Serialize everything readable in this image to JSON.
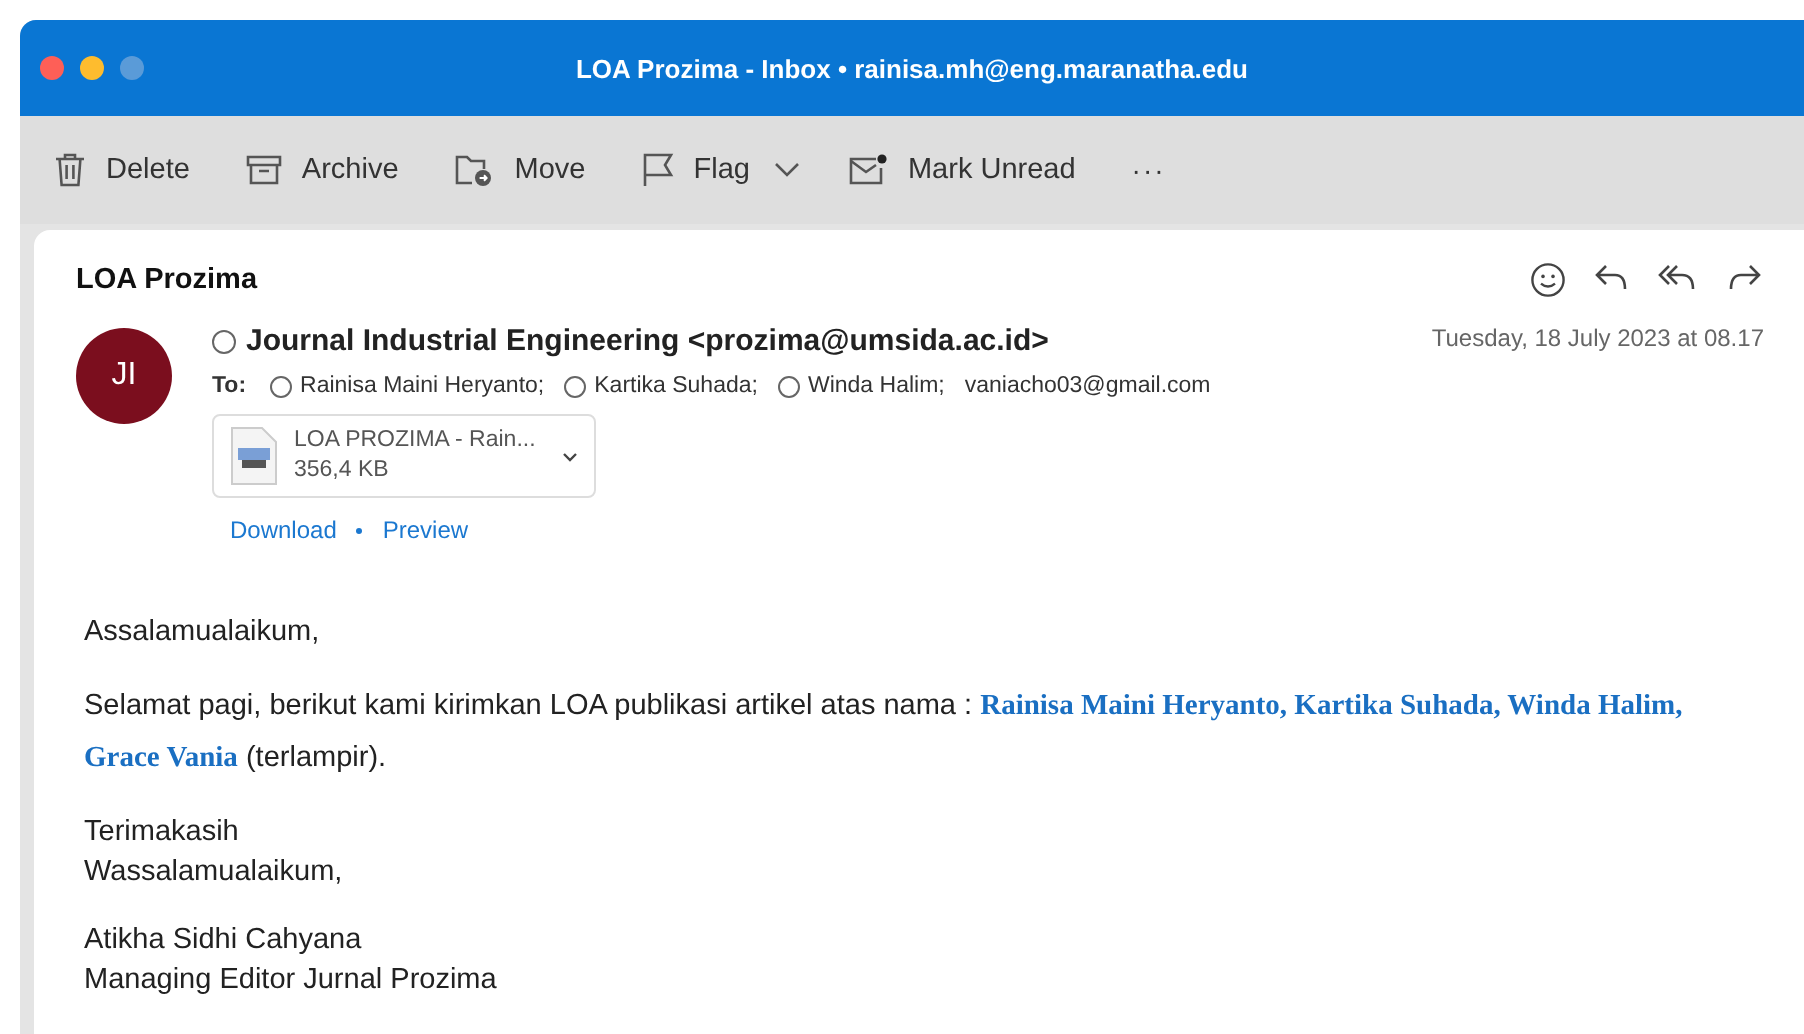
{
  "window": {
    "title": "LOA Prozima - Inbox • rainisa.mh@eng.maranatha.edu"
  },
  "toolbar": [
    {
      "kind": "delete",
      "label": "Delete"
    },
    {
      "kind": "archive",
      "label": "Archive"
    },
    {
      "kind": "move",
      "label": "Move"
    },
    {
      "kind": "flag",
      "label": "Flag"
    },
    {
      "kind": "chevron"
    },
    {
      "kind": "unread",
      "label": "Mark Unread"
    },
    {
      "kind": "more",
      "label": "···"
    }
  ],
  "message": {
    "subject": "LOA Prozima",
    "avatar": "JI",
    "sender": "Journal Industrial Engineering <prozima@umsida.ac.id>",
    "date": "Tuesday, 18 July 2023 at 08.17",
    "to_label": "To:",
    "recipients": [
      {
        "kind": "contact",
        "name": "Rainisa Maini Heryanto;"
      },
      {
        "kind": "contact",
        "name": "Kartika Suhada;"
      },
      {
        "kind": "contact",
        "name": "Winda Halim;"
      },
      {
        "kind": "address",
        "name": "vaniacho03@gmail.com"
      }
    ],
    "attachment": {
      "name": "LOA PROZIMA - Rain...",
      "size": "356,4 KB"
    },
    "attachment_links": [
      "Download",
      "Preview"
    ],
    "actions": [
      {
        "kind": "emoji"
      },
      {
        "kind": "reply"
      },
      {
        "kind": "reply-all"
      },
      {
        "kind": "forward"
      }
    ],
    "body": [
      {
        "kind": "para",
        "lines": [
          "Assalamualaikum,"
        ]
      },
      {
        "kind": "rich",
        "lines": [
          "Selamat pagi, berikut kami kirimkan LOA publikasi artikel atas nama  : **Rainisa Maini Heryanto, Kartika Suhada, Winda Halim, Grace Vania** (terlampir)."
        ]
      },
      {
        "kind": "para",
        "lines": [
          "Terimakasih",
          "Wassalamualaikum,"
        ]
      },
      {
        "kind": "para",
        "lines": [
          "Atikha Sidhi Cahyana",
          "Managing Editor Jurnal Prozima"
        ]
      }
    ]
  }
}
